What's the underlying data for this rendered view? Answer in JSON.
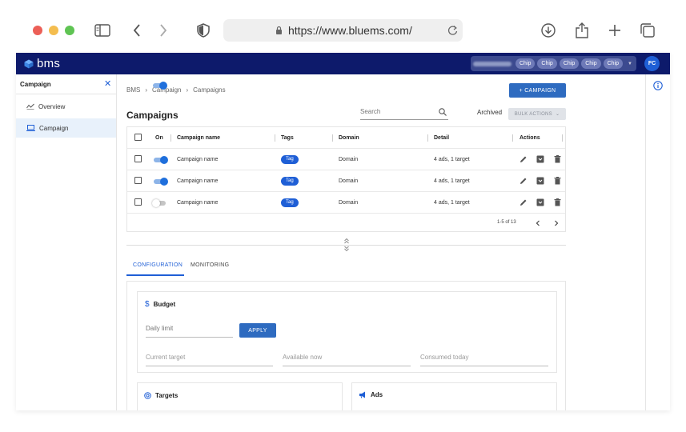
{
  "browser": {
    "url": "https://www.bluems.com/"
  },
  "topbar": {
    "logo_text": "bms",
    "chips": [
      "Chip",
      "Chip",
      "Chip",
      "Chip",
      "Chip"
    ],
    "avatar_initials": "FC",
    "brand_color": "#0d1a6b"
  },
  "sidebar": {
    "title": "Campaign",
    "items": [
      {
        "label": "Overview",
        "icon": "overview-icon",
        "active": false
      },
      {
        "label": "Campaign",
        "icon": "laptop-icon",
        "active": true
      }
    ]
  },
  "main": {
    "breadcrumb": [
      "BMS",
      "Campaign",
      "Campaigns"
    ],
    "add_button_label": "+ CAMPAIGN",
    "title": "Campaigns",
    "search_placeholder": "Search",
    "archived_label": "Archived",
    "bulk_actions_label": "BULK ACTIONS",
    "table": {
      "headers": {
        "on": "On",
        "name": "Campaign name",
        "tags": "Tags",
        "domain": "Domain",
        "detail": "Detail",
        "actions": "Actions"
      },
      "rows": [
        {
          "on": true,
          "name": "Campaign name",
          "tag": "Tag",
          "domain": "Domain",
          "detail": "4 ads, 1 target"
        },
        {
          "on": true,
          "name": "Campaign name",
          "tag": "Tag",
          "domain": "Domain",
          "detail": "4 ads, 1 target"
        },
        {
          "on": false,
          "name": "Campaign name",
          "tag": "Tag",
          "domain": "Domain",
          "detail": "4 ads, 1 target"
        }
      ],
      "pagination": "1-5 of 13"
    },
    "tabs": [
      {
        "label": "CONFIGURATION",
        "active": true
      },
      {
        "label": "MONITORING",
        "active": false
      }
    ],
    "budget": {
      "title": "Budget",
      "daily_limit_label": "Daily limit",
      "apply_label": "APPLY",
      "current_target_label": "Current target",
      "available_now_label": "Available now",
      "consumed_today_label": "Consumed today"
    },
    "targets_title": "Targets",
    "ads_title": "Ads",
    "accent_color": "#1f5fd6"
  }
}
